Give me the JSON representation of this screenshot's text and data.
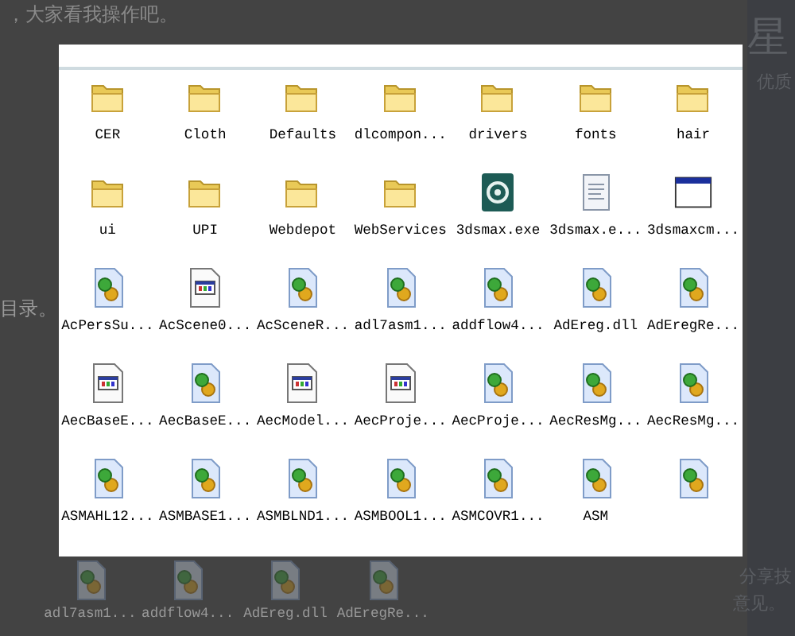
{
  "page": {
    "intro_text": "，大家看我操作吧。",
    "side_label": "目录。",
    "side_title": "星",
    "side_subtitle": "优质",
    "side_note": "分享技",
    "side_note_2": "意见。"
  },
  "background_files": [
    {
      "kind": "dll",
      "name": "adl7asm1..."
    },
    {
      "kind": "dll",
      "name": "addflow4..."
    },
    {
      "kind": "dll",
      "name": "AdEreg.dll"
    },
    {
      "kind": "dll",
      "name": "AdEregRe..."
    }
  ],
  "window": {
    "files": [
      {
        "kind": "folder",
        "name": "CER"
      },
      {
        "kind": "folder",
        "name": "Cloth"
      },
      {
        "kind": "folder",
        "name": "Defaults"
      },
      {
        "kind": "folder",
        "name": "dlcompon..."
      },
      {
        "kind": "folder",
        "name": "drivers"
      },
      {
        "kind": "folder",
        "name": "fonts"
      },
      {
        "kind": "folder",
        "name": "hair"
      },
      {
        "kind": "folder",
        "name": "ui"
      },
      {
        "kind": "folder",
        "name": "UPI"
      },
      {
        "kind": "folder",
        "name": "Webdepot"
      },
      {
        "kind": "folder",
        "name": "WebServices"
      },
      {
        "kind": "max",
        "name": "3dsmax.exe"
      },
      {
        "kind": "text",
        "name": "3dsmax.e..."
      },
      {
        "kind": "window",
        "name": "3dsmaxcm..."
      },
      {
        "kind": "dll",
        "name": "AcPersSu..."
      },
      {
        "kind": "app",
        "name": "AcScene0..."
      },
      {
        "kind": "dll",
        "name": "AcSceneR..."
      },
      {
        "kind": "dll",
        "name": "adl7asm1..."
      },
      {
        "kind": "dll",
        "name": "addflow4..."
      },
      {
        "kind": "dll",
        "name": "AdEreg.dll"
      },
      {
        "kind": "dll",
        "name": "AdEregRe..."
      },
      {
        "kind": "app",
        "name": "AecBaseE..."
      },
      {
        "kind": "dll",
        "name": "AecBaseE..."
      },
      {
        "kind": "app",
        "name": "AecModel..."
      },
      {
        "kind": "app",
        "name": "AecProje..."
      },
      {
        "kind": "dll",
        "name": "AecProje..."
      },
      {
        "kind": "dll",
        "name": "AecResMg..."
      },
      {
        "kind": "dll",
        "name": "AecResMg..."
      },
      {
        "kind": "dll",
        "name": "ASMAHL12..."
      },
      {
        "kind": "dll",
        "name": "ASMBASE1..."
      },
      {
        "kind": "dll",
        "name": "ASMBLND1..."
      },
      {
        "kind": "dll",
        "name": "ASMBOOL1..."
      },
      {
        "kind": "dll",
        "name": "ASMCOVR1..."
      },
      {
        "kind": "dll",
        "name": "ASM"
      },
      {
        "kind": "dll"
      }
    ]
  }
}
